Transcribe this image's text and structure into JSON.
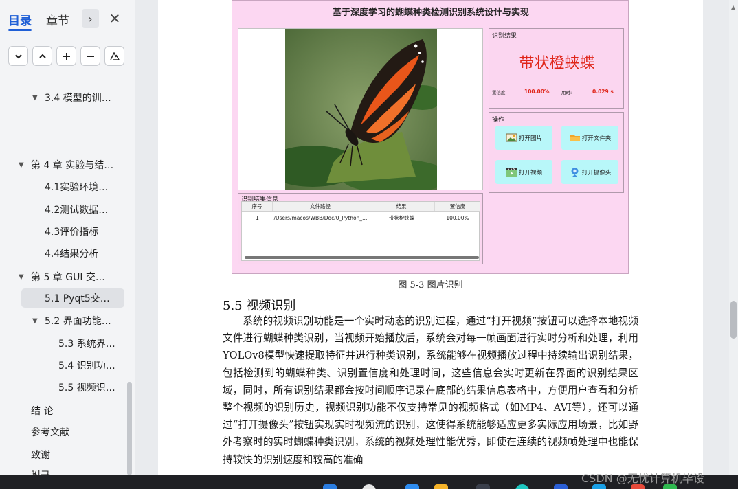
{
  "sidebar": {
    "tabs": [
      {
        "label": "目录"
      },
      {
        "label": "章节"
      }
    ],
    "toc": [
      {
        "label": "3.4 模型的训…",
        "arrow": "▼"
      },
      {
        "label": "第 4 章 实验与结…",
        "arrow": "▼"
      },
      {
        "label": "4.1实验环境…",
        "arrow": ""
      },
      {
        "label": "4.2测试数据…",
        "arrow": ""
      },
      {
        "label": "4.3评价指标",
        "arrow": ""
      },
      {
        "label": "4.4结果分析",
        "arrow": ""
      },
      {
        "label": "第 5 章 GUI 交…",
        "arrow": "▼"
      },
      {
        "label": "5.1 Pyqt5交…",
        "arrow": ""
      },
      {
        "label": "5.2 界面功能…",
        "arrow": "▼"
      },
      {
        "label": "5.3 系统界…",
        "arrow": ""
      },
      {
        "label": "5.4 识别功…",
        "arrow": ""
      },
      {
        "label": "5.5 视频识…",
        "arrow": ""
      },
      {
        "label": "结 论",
        "arrow": ""
      },
      {
        "label": "参考文献",
        "arrow": ""
      },
      {
        "label": "致谢",
        "arrow": ""
      },
      {
        "label": "附录",
        "arrow": ""
      }
    ]
  },
  "figure": {
    "title": "基于深度学习的蝴蝶种类检测识别系统设计与实现",
    "result_group": "识别结果",
    "result_name": "带状橙蛱蝶",
    "confidence_label": "置信度:",
    "confidence_value": "100.00%",
    "time_label": "用时:",
    "time_value": "0.029 s",
    "ops_group": "操作",
    "buttons": [
      {
        "label": "打开图片",
        "icon": "image-icon"
      },
      {
        "label": "打开文件夹",
        "icon": "folder-icon"
      },
      {
        "label": "打开视频",
        "icon": "video-icon"
      },
      {
        "label": "打开摄像头",
        "icon": "camera-icon"
      }
    ],
    "table_group": "识别结果信息",
    "table": {
      "headers": [
        "序号",
        "文件路径",
        "结果",
        "置信度"
      ],
      "rows": [
        [
          "1",
          "/Users/macos/WBB/Doc/0_Python_…",
          "带状橙蛱蝶",
          "100.00%"
        ]
      ]
    },
    "caption": "图 5-3 图片识别"
  },
  "section": {
    "heading": "5.5 视频识别",
    "paragraph": "系统的视频识别功能是一个实时动态的识别过程，通过“打开视频”按钮可以选择本地视频文件进行蝴蝶种类识别，当视频开始播放后，系统会对每一帧画面进行实时分析和处理，利用YOLOv8模型快速提取特征并进行种类识别，系统能够在视频播放过程中持续输出识别结果，包括检测到的蝴蝶种类、识别置信度和处理时间，这些信息会实时更新在界面的识别结果区域，同时，所有识别结果都会按时间顺序记录在底部的结果信息表格中，方便用户查看和分析整个视频的识别历史，视频识别功能不仅支持常见的视频格式（如MP4、AVI等），还可以通过“打开摄像头”按钮实现实时视频流的识别，这使得系统能够适应更多实际应用场景，比如野外考察时的实时蝴蝶种类识别，系统的视频处理性能优秀，即使在连续的视频帧处理中也能保持较快的识别速度和较高的准确"
  },
  "watermark": "CSDN @无忧计算机毕设",
  "colors": {
    "accent": "#1f5fd6",
    "figure_bg": "#fcd7f2",
    "result_red": "#e0261a",
    "button_cyan": "#b8f7f9"
  }
}
